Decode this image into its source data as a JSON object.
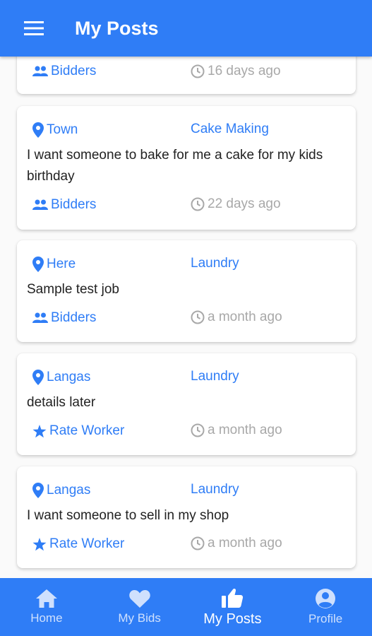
{
  "appbar": {
    "title": "My Posts"
  },
  "partial_card": {
    "action_label": "Bidders",
    "time": "16 days ago"
  },
  "posts": [
    {
      "location": "Town",
      "category": "Cake Making",
      "description": "I want someone to bake for me a cake for my kids birthday",
      "action_label": "Bidders",
      "time": "22 days ago"
    },
    {
      "location": "Here",
      "category": "Laundry",
      "description": "Sample test job",
      "action_label": "Bidders",
      "time": "a month ago"
    },
    {
      "location": "Langas",
      "category": "Laundry",
      "description": "details later",
      "action_label": "Rate Worker",
      "time": "a month ago"
    },
    {
      "location": "Langas",
      "category": "Laundry",
      "description": "I want someone to sell in my shop",
      "action_label": "Rate Worker",
      "time": "a month ago"
    }
  ],
  "bottom_nav": [
    {
      "label": "Home",
      "icon": "home-icon"
    },
    {
      "label": "My Bids",
      "icon": "heart-icon"
    },
    {
      "label": "My Posts",
      "icon": "thumb-up-icon",
      "active": true
    },
    {
      "label": "Profile",
      "icon": "account-circle-icon"
    }
  ],
  "colors": {
    "primary": "#2f7df6",
    "muted": "#a8a8a8"
  }
}
